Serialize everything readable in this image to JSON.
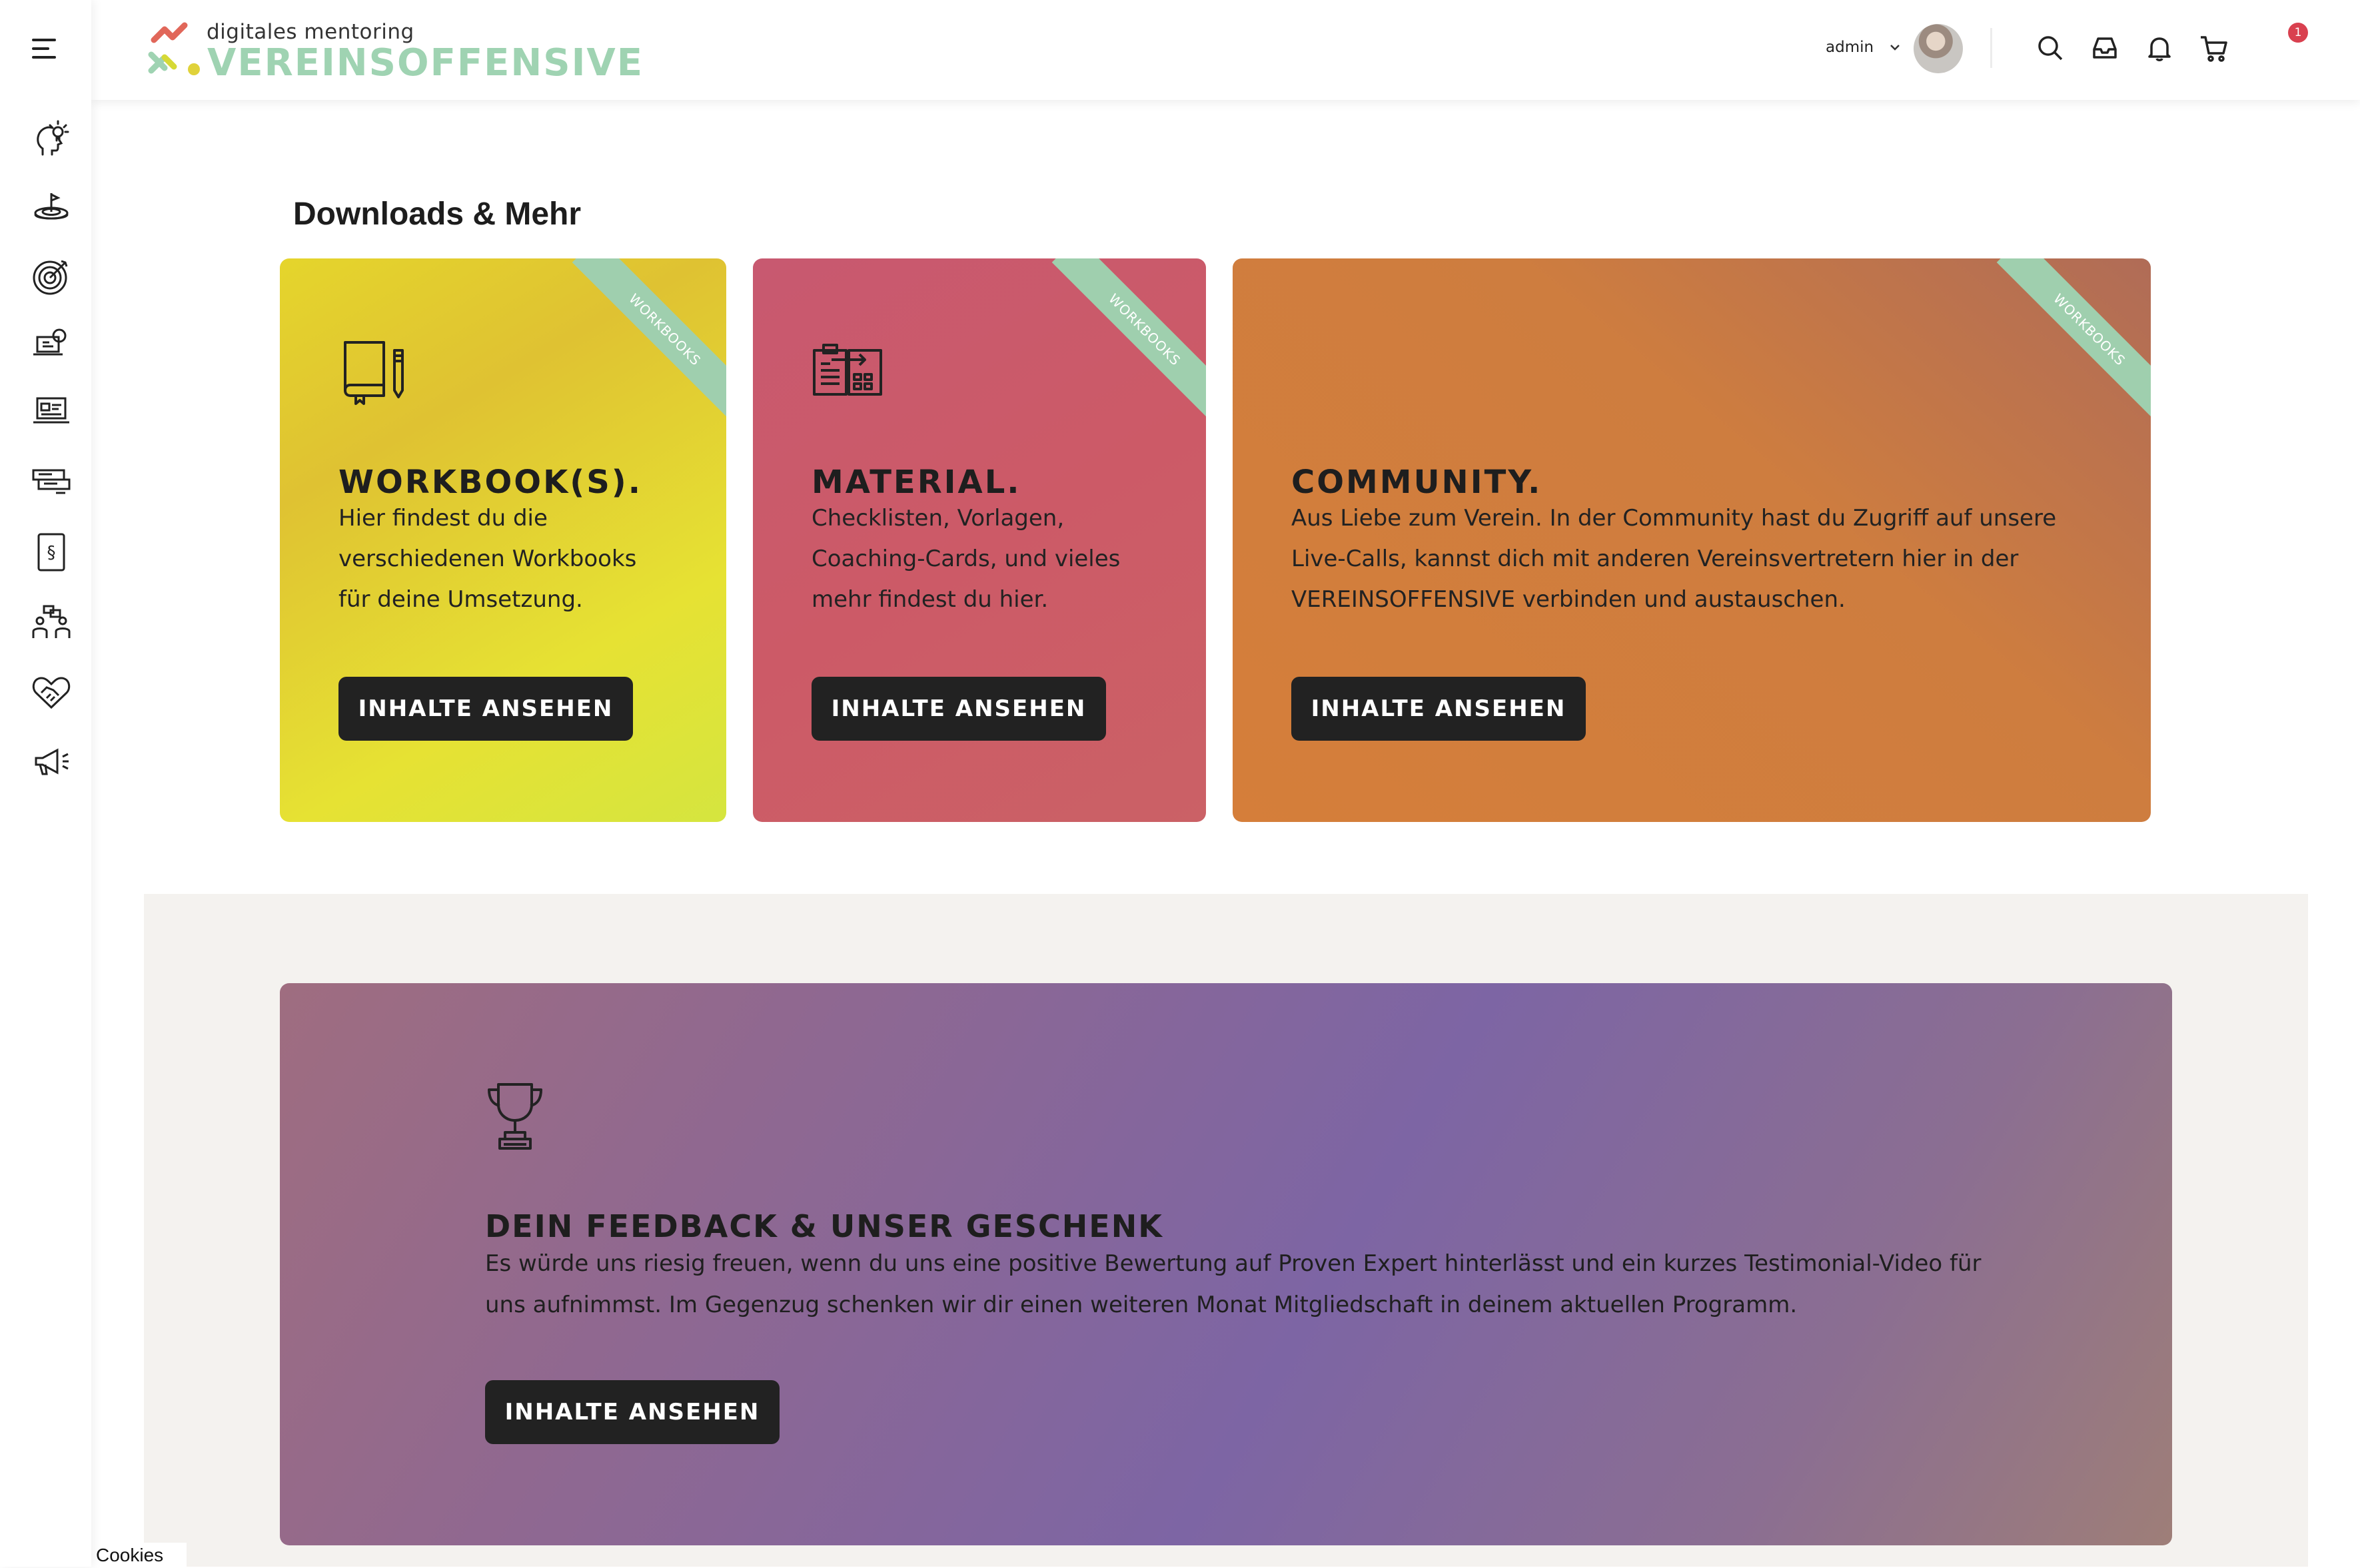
{
  "header": {
    "logo_sub": "digitales mentoring",
    "logo_main": "VEREINSOFFENSIVE",
    "user_name": "admin",
    "cart_count": "1",
    "colors": {
      "logo_green": "#9fd3b2",
      "badge_red": "#d9404f"
    }
  },
  "sidebar": {
    "items": [
      {
        "icon": "head-lightbulb-icon"
      },
      {
        "icon": "target-on-hand-icon"
      },
      {
        "icon": "dartboard-icon"
      },
      {
        "icon": "laptop-chat-icon"
      },
      {
        "icon": "laptop-dashboard-icon"
      },
      {
        "icon": "layout-screens-icon"
      },
      {
        "icon": "law-document-icon"
      },
      {
        "icon": "team-meeting-icon"
      },
      {
        "icon": "heart-handshake-icon"
      },
      {
        "icon": "megaphone-icon"
      }
    ]
  },
  "main": {
    "title": "Downloads & Mehr",
    "cards": [
      {
        "ribbon": "WORKBOOKS",
        "icon": "book-pencil-icon",
        "title": "WORKBOOK(S).",
        "text": "Hier findest du die verschiedenen Workbooks für deine Umsetzung.",
        "button": "INHALTE ANSEHEN"
      },
      {
        "ribbon": "WORKBOOKS",
        "icon": "clipboard-documents-icon",
        "title": "MATERIAL.",
        "text": "Checklisten, Vorlagen, Coaching-Cards, und vieles mehr findest du hier.",
        "button": "INHALTE ANSEHEN"
      },
      {
        "ribbon": "WORKBOOKS",
        "icon": "",
        "title": "COMMUNITY.",
        "text": "Aus Liebe zum Verein. In der Community hast du Zugriff auf unsere Live-Calls, kannst dich mit anderen Vereinsvertretern hier in der VEREINSOFFENSIVE verbinden und austauschen.",
        "button": "INHALTE ANSEHEN"
      }
    ],
    "feedback": {
      "icon": "trophy-icon",
      "title": "DEIN FEEDBACK & UNSER GESCHENK",
      "text": "Es würde uns riesig freuen, wenn du uns eine positive Bewertung auf Proven Expert hinterlässt und ein kurzes Testimonial-Video für uns aufnimmst. Im Gegenzug schenken wir dir einen weiteren Monat Mitgliedschaft in deinem aktuellen Programm.",
      "button": "INHALTE ANSEHEN"
    }
  },
  "footer": {
    "cookies": "Cookies"
  }
}
